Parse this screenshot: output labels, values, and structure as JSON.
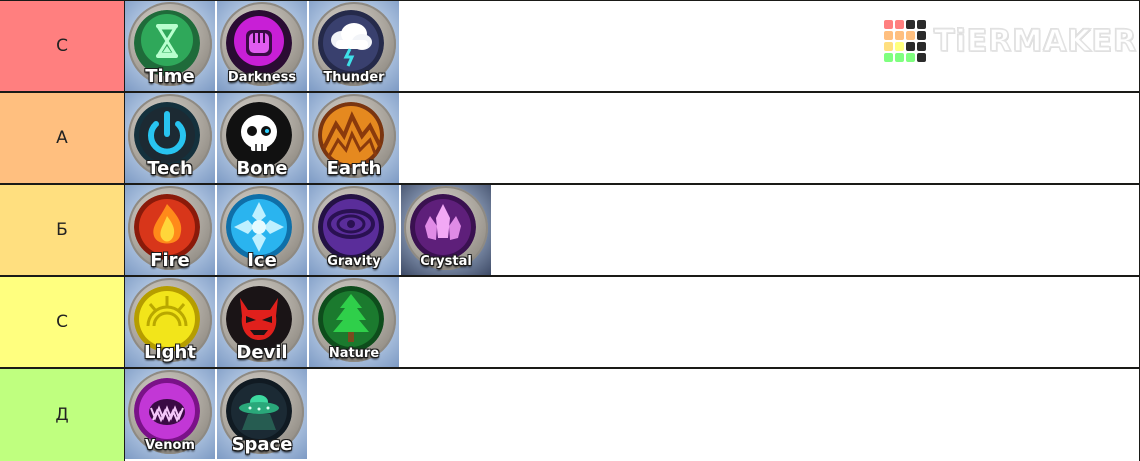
{
  "watermark": {
    "text": "TiERMAKER"
  },
  "tiers": [
    {
      "label": "С",
      "color": "#ff7f7f",
      "items": [
        {
          "name": "Time",
          "icon": "hourglass-icon"
        },
        {
          "name": "Darkness",
          "icon": "fist-icon"
        },
        {
          "name": "Thunder",
          "icon": "storm-cloud-icon"
        }
      ]
    },
    {
      "label": "А",
      "color": "#ffbf7f",
      "items": [
        {
          "name": "Tech",
          "icon": "power-icon"
        },
        {
          "name": "Bone",
          "icon": "skull-icon"
        },
        {
          "name": "Earth",
          "icon": "mountain-icon"
        }
      ]
    },
    {
      "label": "Б",
      "color": "#ffdf7f",
      "items": [
        {
          "name": "Fire",
          "icon": "flame-icon"
        },
        {
          "name": "Ice",
          "icon": "snowflake-icon"
        },
        {
          "name": "Gravity",
          "icon": "eye-vortex-icon"
        },
        {
          "name": "Crystal",
          "icon": "crystal-icon"
        }
      ]
    },
    {
      "label": "С",
      "color": "#ffff7f",
      "items": [
        {
          "name": "Light",
          "icon": "sun-icon"
        },
        {
          "name": "Devil",
          "icon": "devil-face-icon"
        },
        {
          "name": "Nature",
          "icon": "tree-icon"
        }
      ]
    },
    {
      "label": "Д",
      "color": "#bfff7f",
      "items": [
        {
          "name": "Venom",
          "icon": "venom-mouth-icon"
        },
        {
          "name": "Space",
          "icon": "ufo-icon"
        }
      ]
    }
  ]
}
